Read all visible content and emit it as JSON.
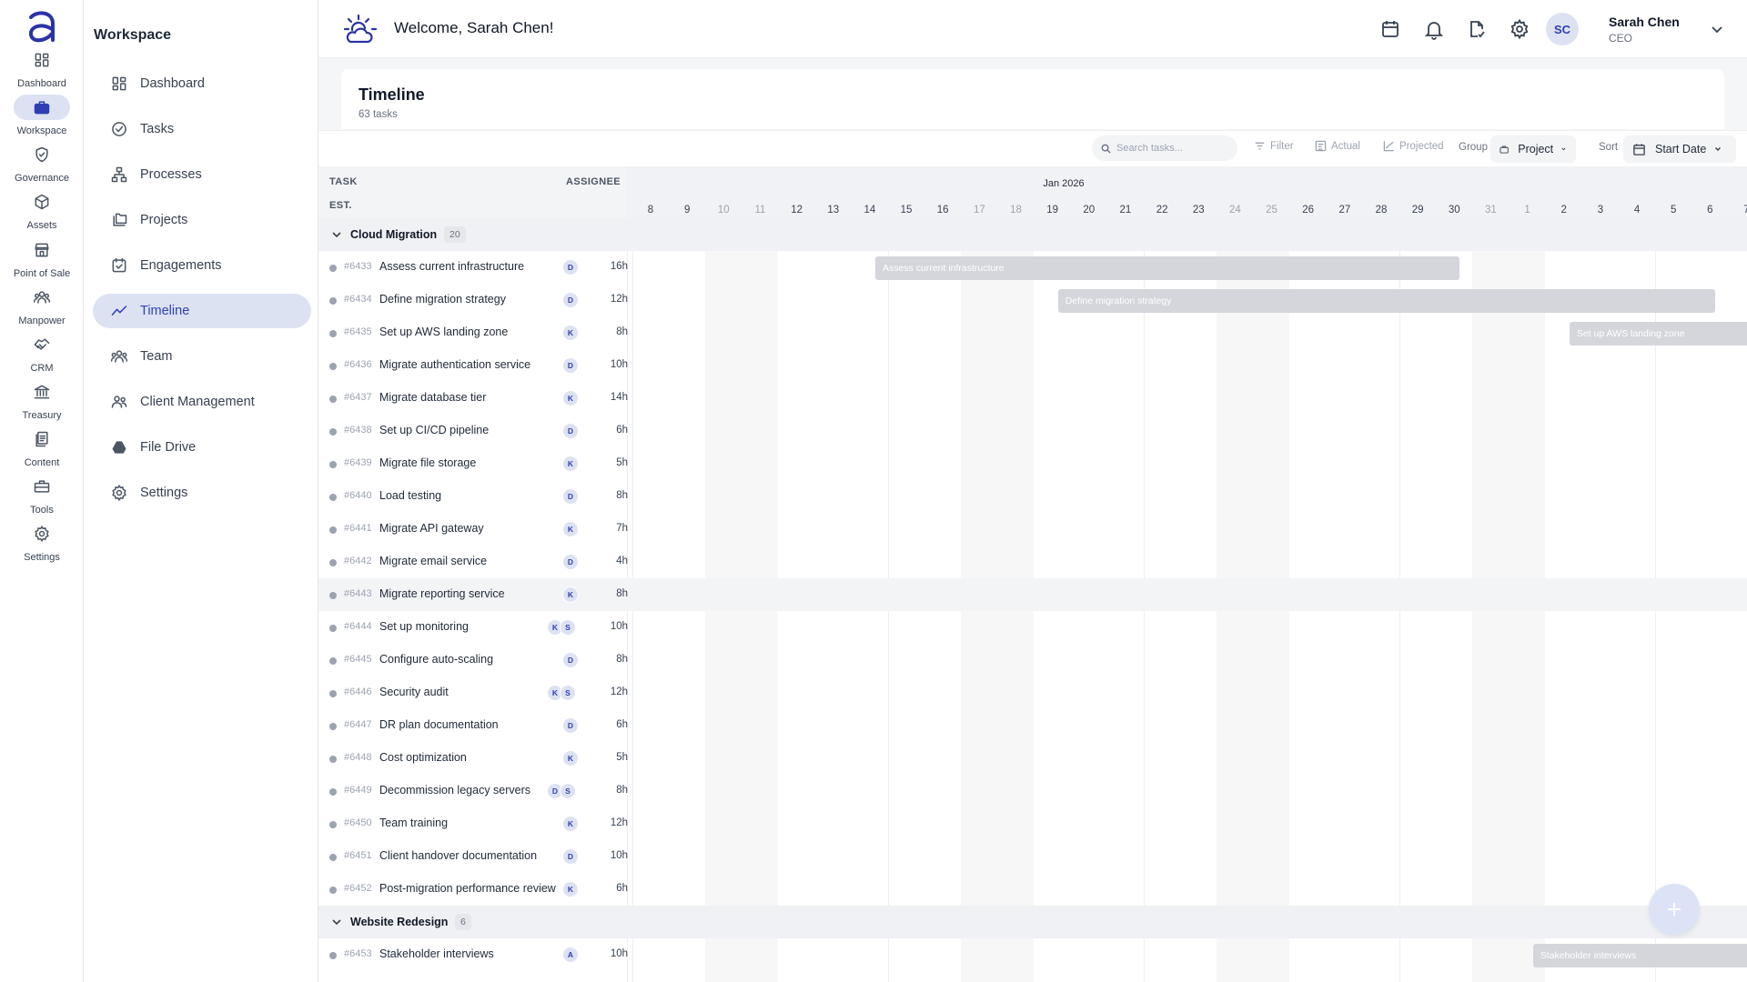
{
  "rail": {
    "items": [
      {
        "label": "Dashboard",
        "icon": "dashboard-icon"
      },
      {
        "label": "Workspace",
        "icon": "briefcase-icon"
      },
      {
        "label": "Governance",
        "icon": "shield-check-icon"
      },
      {
        "label": "Assets",
        "icon": "cube-icon"
      },
      {
        "label": "Point of Sale",
        "icon": "store-icon"
      },
      {
        "label": "Manpower",
        "icon": "people-icon"
      },
      {
        "label": "CRM",
        "icon": "handshake-icon"
      },
      {
        "label": "Treasury",
        "icon": "bank-icon"
      },
      {
        "label": "Content",
        "icon": "documents-icon"
      },
      {
        "label": "Tools",
        "icon": "toolbox-icon"
      },
      {
        "label": "Settings",
        "icon": "gear-icon"
      }
    ]
  },
  "sidenav": {
    "title": "Workspace",
    "items": [
      {
        "label": "Dashboard"
      },
      {
        "label": "Tasks"
      },
      {
        "label": "Processes"
      },
      {
        "label": "Projects"
      },
      {
        "label": "Engagements"
      },
      {
        "label": "Timeline"
      },
      {
        "label": "Team"
      },
      {
        "label": "Client Management"
      },
      {
        "label": "File Drive"
      },
      {
        "label": "Settings"
      }
    ]
  },
  "header": {
    "welcome": "Welcome, Sarah Chen!",
    "user": {
      "initials": "SC",
      "name": "Sarah Chen",
      "role": "CEO"
    }
  },
  "page": {
    "title": "Timeline",
    "subtitle": "63 tasks"
  },
  "toolbar": {
    "search_placeholder": "Search tasks...",
    "filter": "Filter",
    "actual": "Actual",
    "projected": "Projected",
    "group_label": "Group",
    "group_value": "Project",
    "sort_label": "Sort",
    "sort_value": "Start Date"
  },
  "grid": {
    "col_task": "TASK",
    "col_assignee": "ASSIGNEE",
    "col_est": "EST.",
    "month": "Jan 2026",
    "days": [
      "8",
      "9",
      "10",
      "11",
      "12",
      "13",
      "14",
      "15",
      "16",
      "17",
      "18",
      "19",
      "20",
      "21",
      "22",
      "23",
      "24",
      "25",
      "26",
      "27",
      "28",
      "29",
      "30",
      "31",
      "1",
      "2",
      "3",
      "4",
      "5",
      "6",
      "7"
    ]
  },
  "groups": [
    {
      "name": "Cloud Migration",
      "count": "20",
      "tasks": [
        {
          "id": "#6433",
          "name": "Assess current infrastructure",
          "assignees": [
            "D"
          ],
          "est": "16h",
          "bar": {
            "start_day_index": 6.65,
            "span_days": 16,
            "label": "Assess current infrastructure"
          }
        },
        {
          "id": "#6434",
          "name": "Define migration strategy",
          "assignees": [
            "D"
          ],
          "est": "12h",
          "bar": {
            "start_day_index": 11.65,
            "span_days": 18,
            "label": "Define migration strategy"
          }
        },
        {
          "id": "#6435",
          "name": "Set up AWS landing zone",
          "assignees": [
            "K"
          ],
          "est": "8h",
          "bar": {
            "start_day_index": 25.65,
            "span_days": 6,
            "label": "Set up AWS landing zone"
          }
        },
        {
          "id": "#6436",
          "name": "Migrate authentication service",
          "assignees": [
            "D"
          ],
          "est": "10h"
        },
        {
          "id": "#6437",
          "name": "Migrate database tier",
          "assignees": [
            "K"
          ],
          "est": "14h"
        },
        {
          "id": "#6438",
          "name": "Set up CI/CD pipeline",
          "assignees": [
            "D"
          ],
          "est": "6h"
        },
        {
          "id": "#6439",
          "name": "Migrate file storage",
          "assignees": [
            "K"
          ],
          "est": "5h"
        },
        {
          "id": "#6440",
          "name": "Load testing",
          "assignees": [
            "D"
          ],
          "est": "8h"
        },
        {
          "id": "#6441",
          "name": "Migrate API gateway",
          "assignees": [
            "K"
          ],
          "est": "7h"
        },
        {
          "id": "#6442",
          "name": "Migrate email service",
          "assignees": [
            "D"
          ],
          "est": "4h"
        },
        {
          "id": "#6443",
          "name": "Migrate reporting service",
          "assignees": [
            "K"
          ],
          "est": "8h",
          "highlight": true
        },
        {
          "id": "#6444",
          "name": "Set up monitoring",
          "assignees": [
            "K",
            "S"
          ],
          "est": "10h"
        },
        {
          "id": "#6445",
          "name": "Configure auto-scaling",
          "assignees": [
            "D"
          ],
          "est": "8h"
        },
        {
          "id": "#6446",
          "name": "Security audit",
          "assignees": [
            "K",
            "S"
          ],
          "est": "12h"
        },
        {
          "id": "#6447",
          "name": "DR plan documentation",
          "assignees": [
            "D"
          ],
          "est": "6h"
        },
        {
          "id": "#6448",
          "name": "Cost optimization",
          "assignees": [
            "K"
          ],
          "est": "5h"
        },
        {
          "id": "#6449",
          "name": "Decommission legacy servers",
          "assignees": [
            "D",
            "S"
          ],
          "est": "8h"
        },
        {
          "id": "#6450",
          "name": "Team training",
          "assignees": [
            "K"
          ],
          "est": "12h"
        },
        {
          "id": "#6451",
          "name": "Client handover documentation",
          "assignees": [
            "D"
          ],
          "est": "10h"
        },
        {
          "id": "#6452",
          "name": "Post-migration performance review",
          "assignees": [
            "K"
          ],
          "est": "6h"
        }
      ]
    },
    {
      "name": "Website Redesign",
      "count": "6",
      "tasks": [
        {
          "id": "#6453",
          "name": "Stakeholder interviews",
          "assignees": [
            "A"
          ],
          "est": "10h",
          "bar": {
            "start_day_index": 24.65,
            "span_days": 7,
            "label": "Stakeholder interviews"
          }
        }
      ]
    }
  ],
  "colors": {
    "accent": "#2f3fb3",
    "accent_soft": "#dde2f3",
    "bar": "#d4d6db"
  }
}
